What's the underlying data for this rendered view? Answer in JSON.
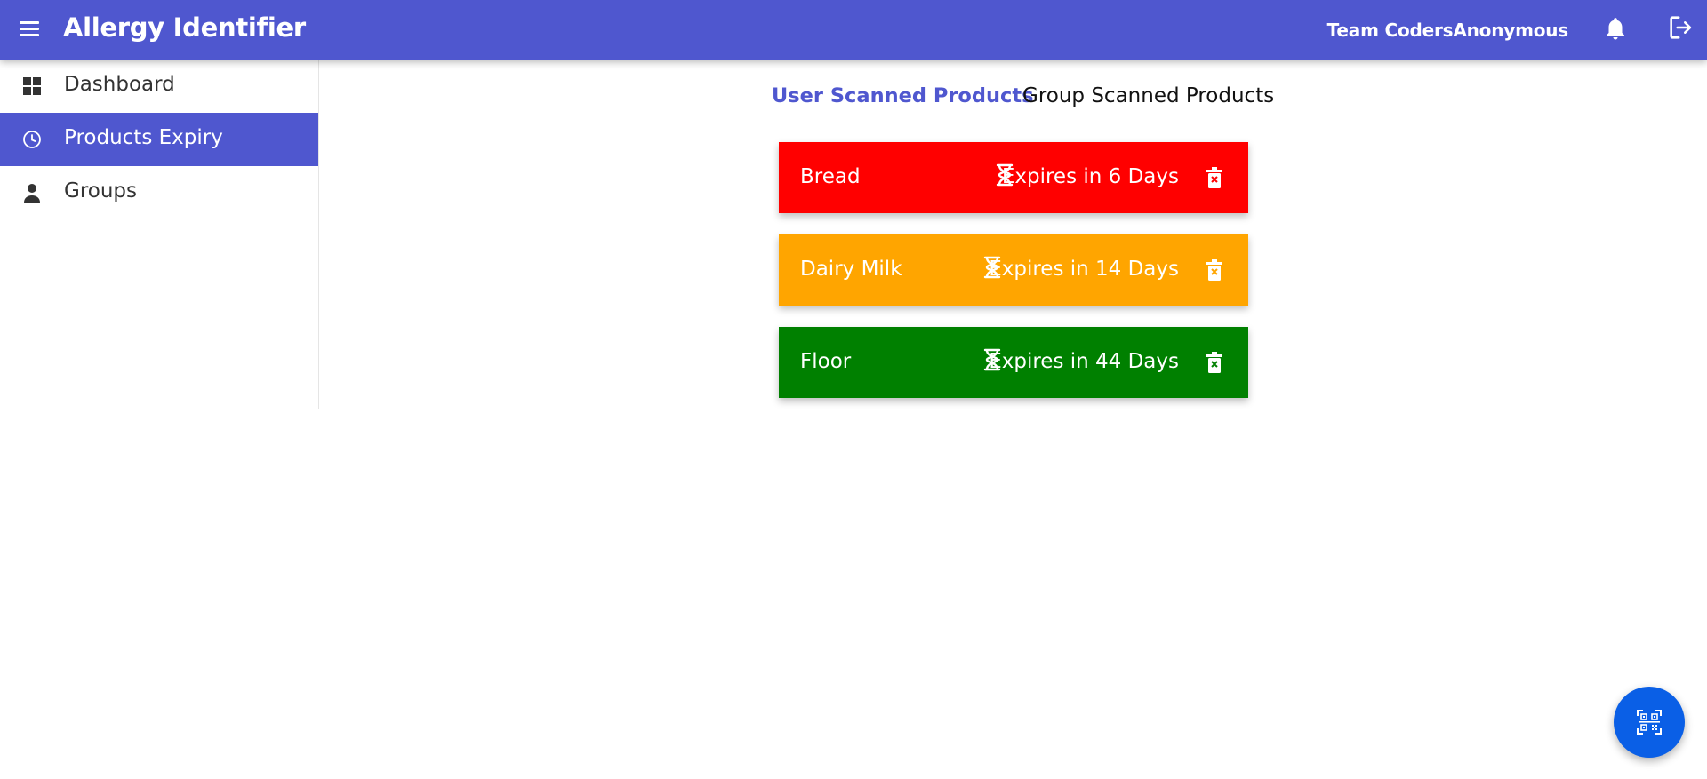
{
  "header": {
    "title": "Allergy Identifier",
    "team": "Team CodersAnonymous",
    "icons": [
      "menu-icon",
      "bell-icon",
      "logout-icon"
    ],
    "background": "#4f57cf"
  },
  "sidebar": {
    "items": [
      {
        "label": "Dashboard",
        "icon": "dashboard-icon",
        "active": false
      },
      {
        "label": "Products Expiry",
        "icon": "clock-icon",
        "active": true
      },
      {
        "label": "Groups",
        "icon": "person-icon",
        "active": false
      }
    ]
  },
  "tabs": [
    {
      "label": "User Scanned Products",
      "active": true
    },
    {
      "label": "Group Scanned Products",
      "active": false
    }
  ],
  "products": [
    {
      "name": "Bread",
      "expiry": "Expires in 6 Days",
      "color": "#ff0000"
    },
    {
      "name": "Dairy Milk",
      "expiry": "Expires in 14 Days",
      "color": "#ffa500"
    },
    {
      "name": "Floor",
      "expiry": "Expires in 44 Days",
      "color": "#008000"
    }
  ],
  "fab": {
    "icon": "qr-scan-icon",
    "color": "#0a5fe6"
  }
}
